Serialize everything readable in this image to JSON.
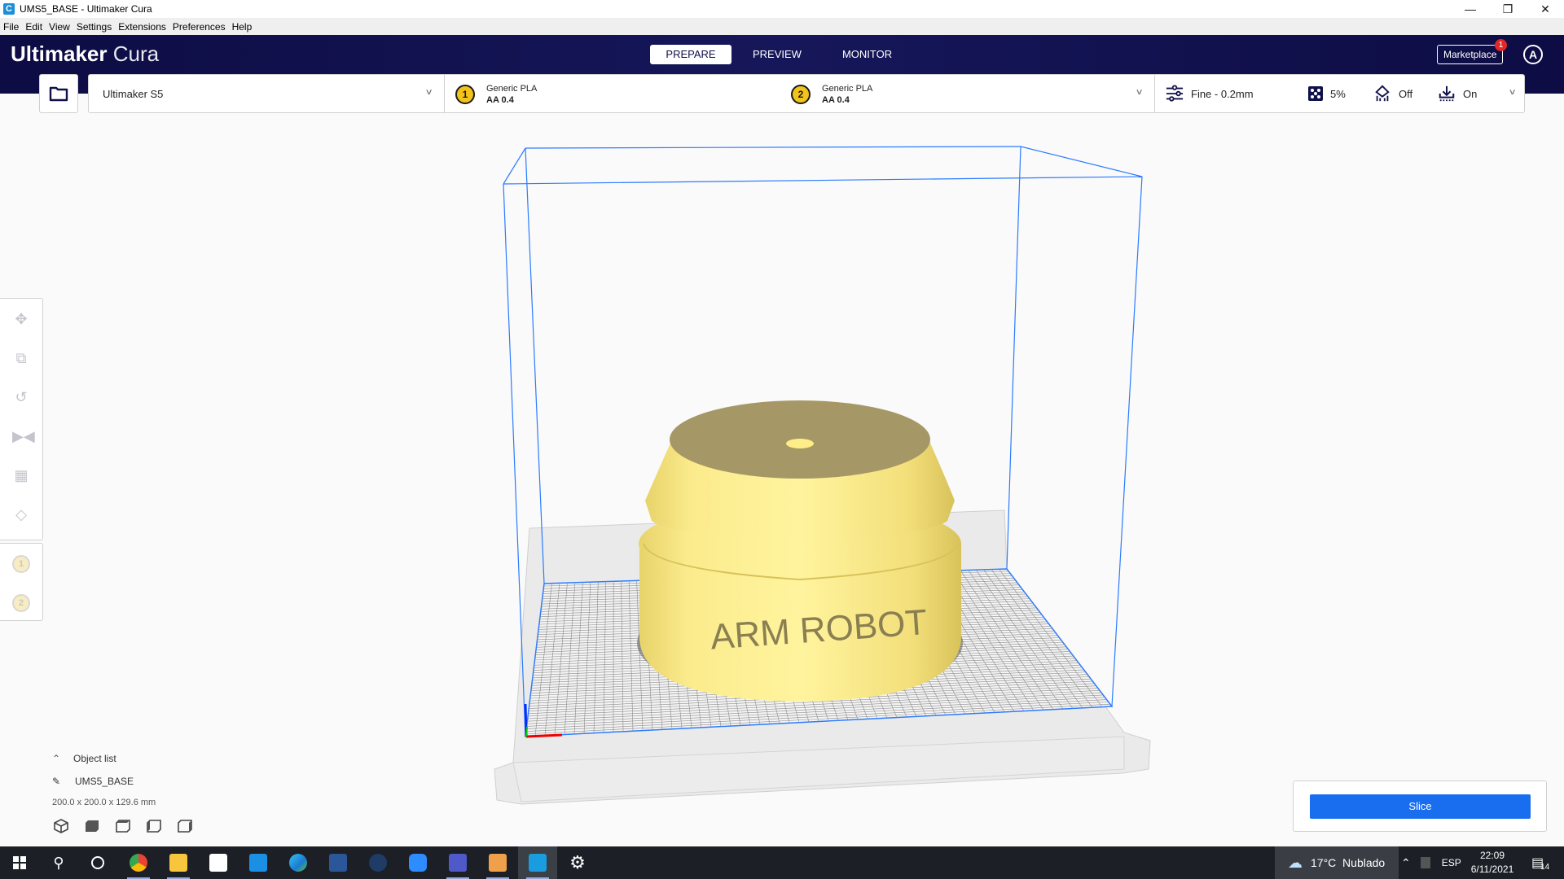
{
  "window": {
    "title": "UMS5_BASE - Ultimaker Cura",
    "controls": [
      "minimize",
      "restore",
      "close"
    ]
  },
  "menu": {
    "items": [
      "File",
      "Edit",
      "View",
      "Settings",
      "Extensions",
      "Preferences",
      "Help"
    ]
  },
  "header": {
    "logo_bold": "Ultimaker",
    "logo_light": "Cura",
    "stages": [
      {
        "label": "PREPARE",
        "active": true
      },
      {
        "label": "PREVIEW",
        "active": false
      },
      {
        "label": "MONITOR",
        "active": false
      }
    ],
    "marketplace_label": "Marketplace",
    "marketplace_badge": "1",
    "account_initial": "A"
  },
  "toolbar": {
    "printer": "Ultimaker S5",
    "extruders": [
      {
        "index": "1",
        "material": "Generic PLA",
        "nozzle": "AA 0.4"
      },
      {
        "index": "2",
        "material": "Generic PLA",
        "nozzle": "AA 0.4"
      }
    ],
    "print_settings": {
      "profile": "Fine - 0.2mm",
      "infill": "5%",
      "support": "Off",
      "adhesion": "On"
    }
  },
  "left_tools": [
    "move",
    "scale",
    "rotate",
    "mirror",
    "per-model-settings",
    "support-blocker"
  ],
  "extruder_tools": [
    "1",
    "2"
  ],
  "viewport": {
    "model_text": "ARM ROBOT",
    "colors": {
      "model": "#f5e27a",
      "build_volume": "#2b7bff",
      "slice_button": "#196ef0"
    }
  },
  "object_list": {
    "header": "Object list",
    "object_name": "UMS5_BASE",
    "dimensions": "200.0 x 200.0 x 129.6 mm",
    "view_buttons": [
      "3d-view",
      "front-view",
      "top-view",
      "left-view",
      "right-view"
    ]
  },
  "action_panel": {
    "slice_label": "Slice"
  },
  "taskbar": {
    "apps": [
      "start",
      "search",
      "cortana",
      "chrome",
      "file-explorer",
      "store",
      "mail",
      "edge",
      "word",
      "steam",
      "zoom",
      "teams",
      "fusion",
      "cura",
      "settings"
    ],
    "weather": "17°C  Nublado",
    "language": "ESP",
    "time": "22:09",
    "date": "6/11/2021",
    "notifications": "14"
  }
}
